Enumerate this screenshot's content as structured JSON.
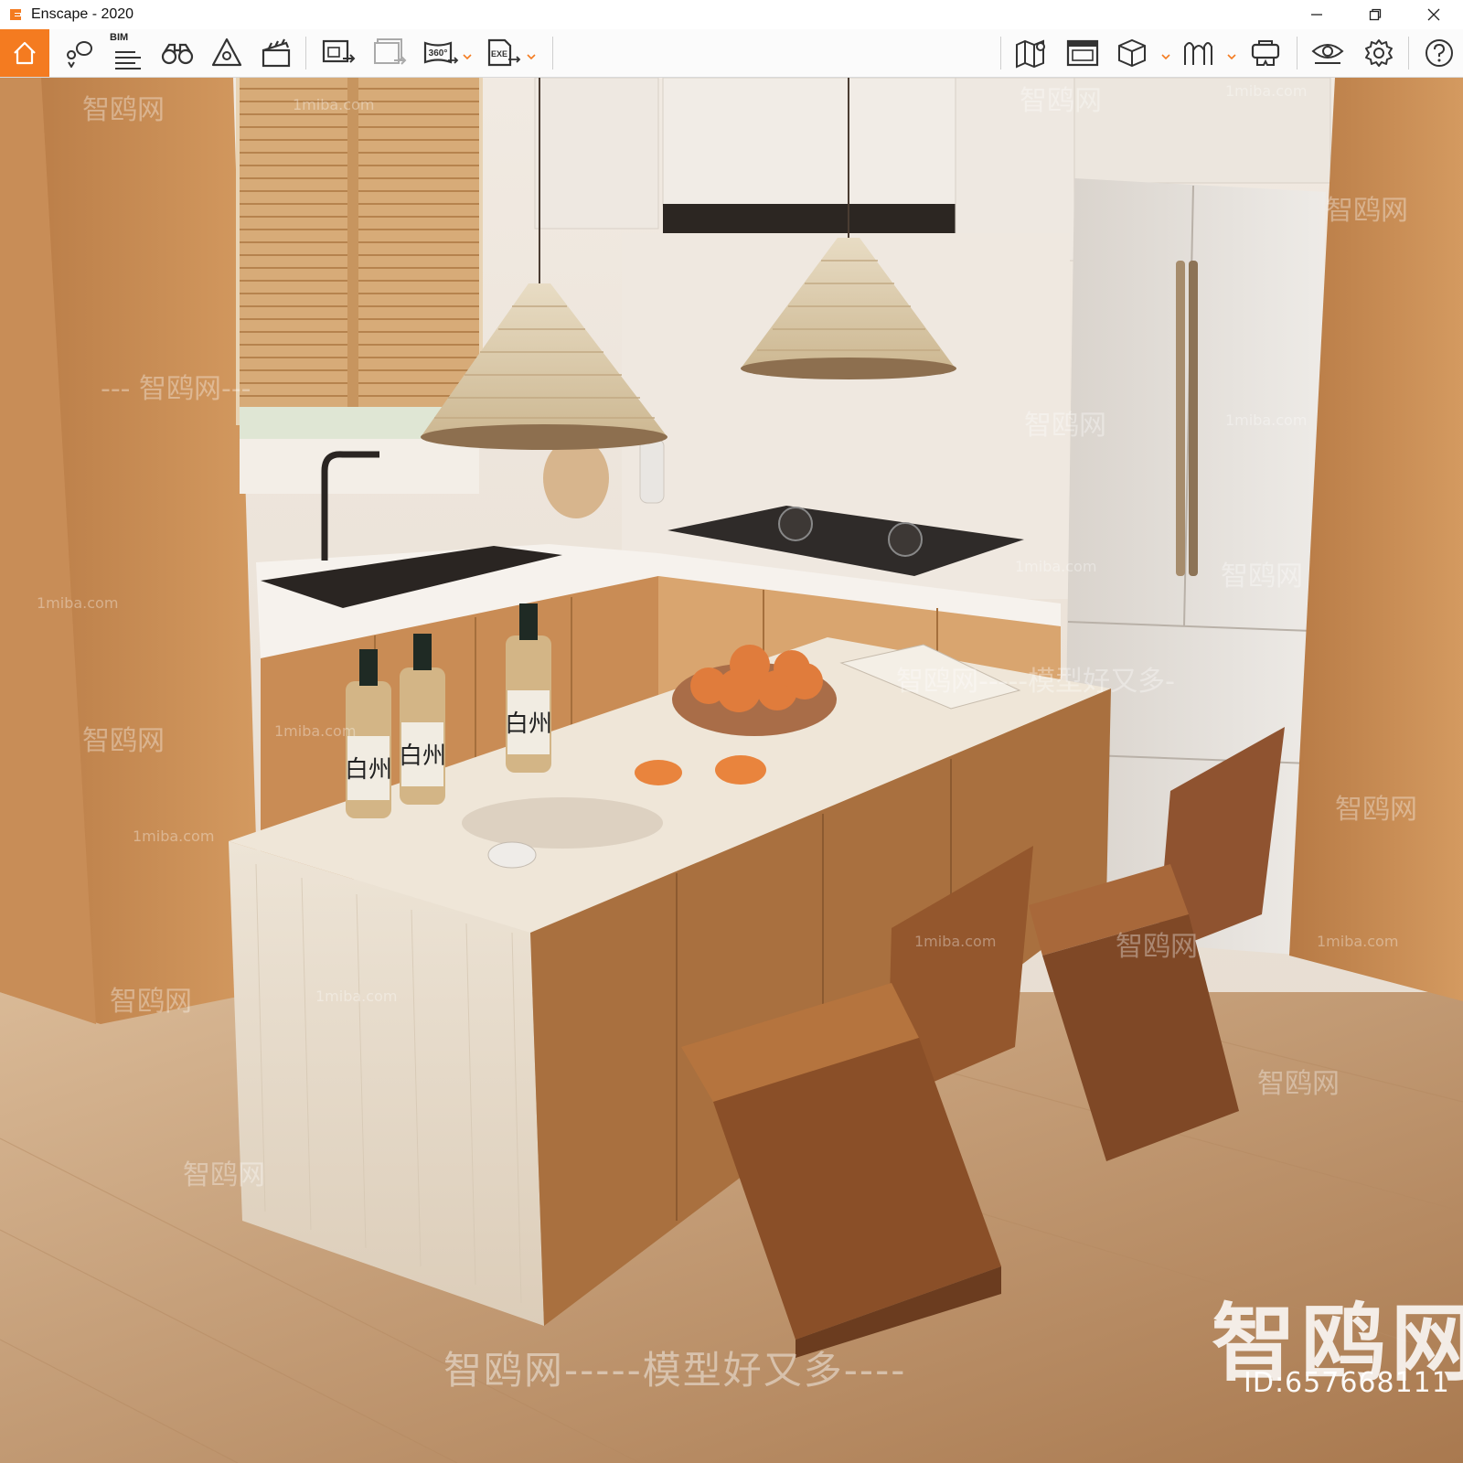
{
  "window": {
    "title": "Enscape - 2020"
  },
  "toolbar": {
    "bim_label": "BIM",
    "icons": [
      "home-icon",
      "location-icon",
      "bim-icon",
      "binoculars-icon",
      "shield-icon",
      "clapperboard-icon",
      "batch-render-icon",
      "render-export-icon",
      "panorama-360-icon",
      "exe-export-icon",
      "map-icon",
      "screenshot-list-icon",
      "cube-icon",
      "asset-library-icon",
      "vr-headset-icon",
      "eye-icon",
      "gear-icon",
      "help-icon"
    ],
    "panorama_text": "360°",
    "exe_text": "EXE"
  },
  "watermarks": {
    "big": "智鸥网",
    "bottom": "智鸥网-----模型好又多----",
    "id": "ID:657668111",
    "site": "1miba.com",
    "brand": "智鸥网",
    "slogan": "智鸥网-----模型好又多-",
    "dashed_brand": "--- 智鸥网---"
  },
  "scene": {
    "bottle_label": "白州",
    "colors": {
      "accent": "#f47b20",
      "wood": "#c98c55",
      "stone": "#e9dccb",
      "floor": "#c9a07a"
    }
  }
}
